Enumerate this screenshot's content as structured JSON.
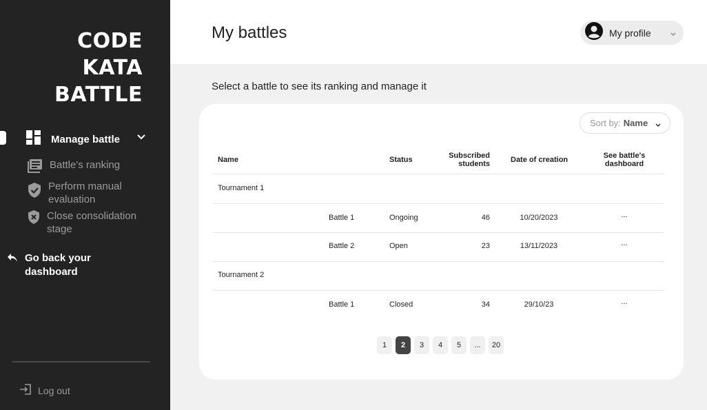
{
  "sidebar": {
    "logo_lines": [
      "CODE",
      "KATA",
      "BATTLE"
    ],
    "manage_label": "Manage battle",
    "sub_items": [
      {
        "label": "Battle's ranking",
        "icon": "ranking-list-icon"
      },
      {
        "label": "Perform manual evaluation",
        "icon": "shield-check-icon"
      },
      {
        "label": "Close consolidation stage",
        "icon": "shield-x-icon"
      }
    ],
    "back_label": "Go back your dashboard",
    "logout_label": "Log out"
  },
  "header": {
    "title": "My battles",
    "profile_label": "My profile"
  },
  "main": {
    "subtitle": "Select a battle to see its ranking and manage it",
    "sort": {
      "prefix": "Sort by:",
      "value": "Name"
    },
    "columns": {
      "name": "Name",
      "status": "Status",
      "students_line1": "Subscribed",
      "students_line2": "students",
      "date": "Date of creation",
      "dashboard_line1": "See battle's",
      "dashboard_line2": "dashboard"
    },
    "tournaments": [
      {
        "name": "Tournament 1",
        "battles": [
          {
            "name": "Battle 1",
            "status": "Ongoing",
            "students": "46",
            "date": "10/20/2023",
            "action": "..."
          },
          {
            "name": "Battle 2",
            "status": "Open",
            "students": "23",
            "date": "13/11/2023",
            "action": "..."
          }
        ]
      },
      {
        "name": "Tournament 2",
        "battles": [
          {
            "name": "Battle 1",
            "status": "Closed",
            "students": "34",
            "date": "29/10/23",
            "action": "..."
          }
        ]
      }
    ],
    "pagination": {
      "pages": [
        "1",
        "2",
        "3",
        "4",
        "5",
        "...",
        "20"
      ],
      "current": "2"
    }
  },
  "colors": {
    "sidebar_bg": "#232323",
    "page_bg": "#f1f1f1",
    "active_page": "#444444"
  }
}
